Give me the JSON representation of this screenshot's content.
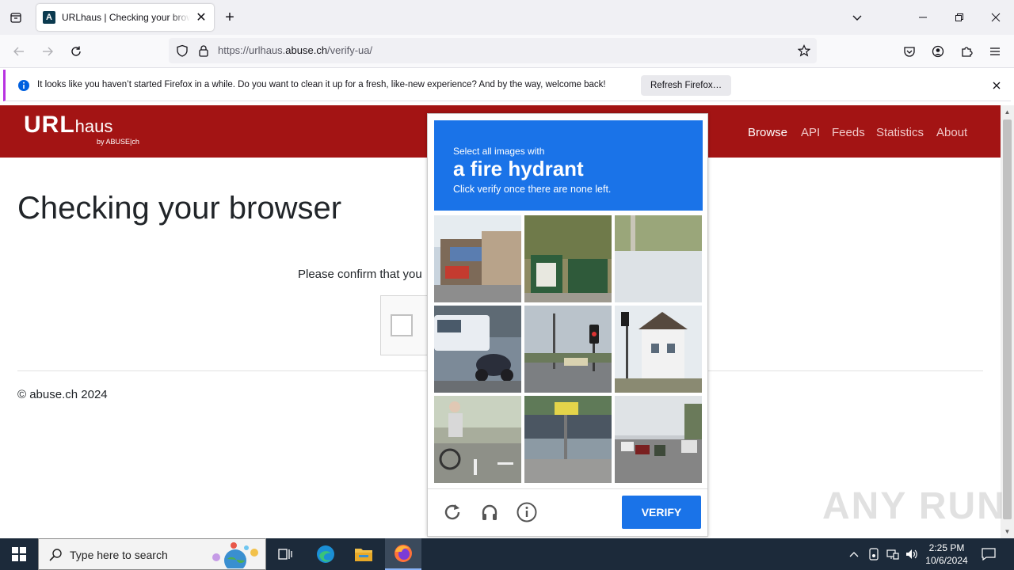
{
  "browser": {
    "tab_title": "URLhaus | Checking your browser",
    "favicon_letter": "A",
    "url_prefix": "https://urlhaus.",
    "url_domain": "abuse.ch",
    "url_path": "/verify-ua/"
  },
  "notification": {
    "message": "It looks like you haven’t started Firefox in a while. Do you want to clean it up for a fresh, like-new experience? And by the way, welcome back!",
    "button": "Refresh Firefox…"
  },
  "site": {
    "logo_main": "URL",
    "logo_haus": "haus",
    "logo_sub": "by ABUSE|ch",
    "nav": [
      "Browse",
      "API",
      "Feeds",
      "Statistics",
      "About"
    ],
    "heading": "Checking your browser",
    "confirm_text": "Please confirm that you",
    "footer": "© abuse.ch 2024"
  },
  "captcha": {
    "line1": "Select all images with",
    "line2": "a fire hydrant",
    "line3": "Click verify once there are none left.",
    "verify": "VERIFY"
  },
  "watermark": "ANY RUN",
  "taskbar": {
    "search_placeholder": "Type here to search",
    "time": "2:25 PM",
    "date": "10/6/2024"
  }
}
